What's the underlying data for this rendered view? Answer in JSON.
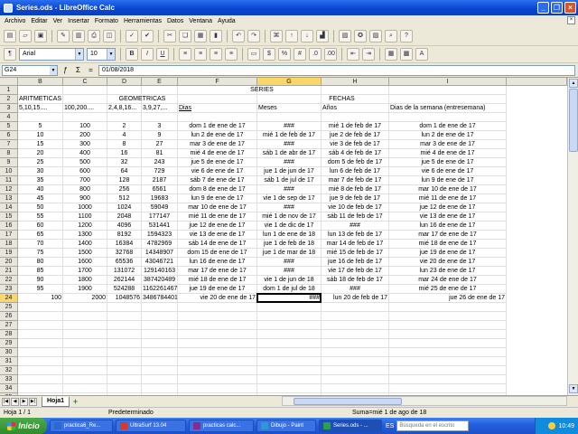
{
  "window": {
    "title": "Series.ods - LibreOffice Calc"
  },
  "menu": [
    "Archivo",
    "Editar",
    "Ver",
    "Insertar",
    "Formato",
    "Herramientas",
    "Datos",
    "Ventana",
    "Ayuda"
  ],
  "font": {
    "name": "Arial",
    "size": "10"
  },
  "formula_bar": {
    "cell_ref": "G24",
    "content": "01/08/2018"
  },
  "columns": [
    "B",
    "C",
    "D",
    "E",
    "F",
    "G",
    "H",
    "I"
  ],
  "selected": {
    "column": "G",
    "row": "24"
  },
  "rows": [
    "1",
    "2",
    "3",
    "4",
    "5",
    "6",
    "7",
    "8",
    "9",
    "10",
    "11",
    "12",
    "13",
    "14",
    "15",
    "16",
    "17",
    "18",
    "19",
    "20",
    "21",
    "22",
    "23",
    "24",
    "25",
    "26",
    "27",
    "28",
    "29",
    "30",
    "31",
    "32",
    "33",
    "34",
    "35",
    "36"
  ],
  "headings": {
    "series": "SERIES",
    "aritmeticas": "ARITMETICAS",
    "geometricas": "GEOMETRICAS",
    "fechas": "FECHAS",
    "ar_1": "5,10,15....",
    "ar_2": "100,200....",
    "geo_1": "2,4,8,16...",
    "geo_2": "3,9,27,...",
    "dias": "Dias",
    "meses": "Meses",
    "anios": "Años",
    "dias_semana": "Dias de la semana (entresemana)"
  },
  "table": [
    [
      "5",
      "100",
      "2",
      "3",
      "dom 1 de ene de 17",
      "###",
      "mié 1 de feb de 17",
      "dom 1 de ene de 17"
    ],
    [
      "10",
      "200",
      "4",
      "9",
      "lun 2 de ene de 17",
      "mié 1 de feb de 17",
      "jue 2 de feb de 17",
      "lun 2 de ene de 17"
    ],
    [
      "15",
      "300",
      "8",
      "27",
      "mar 3 de ene de 17",
      "###",
      "vie 3 de feb de 17",
      "mar 3 de ene de 17"
    ],
    [
      "20",
      "400",
      "16",
      "81",
      "mié 4 de ene de 17",
      "sáb 1 de abr de 17",
      "sáb 4 de feb de 17",
      "mié 4 de ene de 17"
    ],
    [
      "25",
      "500",
      "32",
      "243",
      "jue 5 de ene de 17",
      "###",
      "dom 5 de feb de 17",
      "jue 5 de ene de 17"
    ],
    [
      "30",
      "600",
      "64",
      "729",
      "vie 6 de ene de 17",
      "jue 1 de jun de 17",
      "lun 6 de feb de 17",
      "vie 6 de ene de 17"
    ],
    [
      "35",
      "700",
      "128",
      "2187",
      "sáb 7 de ene de 17",
      "sáb 1 de jul de 17",
      "mar 7 de feb de 17",
      "lun 9 de ene de 17"
    ],
    [
      "40",
      "800",
      "256",
      "6561",
      "dom 8 de ene de 17",
      "###",
      "mié 8 de feb de 17",
      "mar 10 de ene de 17"
    ],
    [
      "45",
      "900",
      "512",
      "19683",
      "lun 9 de ene de 17",
      "vie 1 de sep de 17",
      "jue 9 de feb de 17",
      "mié 11 de ene de 17"
    ],
    [
      "50",
      "1000",
      "1024",
      "59049",
      "mar 10 de ene de 17",
      "###",
      "vie 10 de feb de 17",
      "jue 12 de ene de 17"
    ],
    [
      "55",
      "1100",
      "2048",
      "177147",
      "mié 11 de ene de 17",
      "mié 1 de nov de 17",
      "sáb 11 de feb de 17",
      "vie 13 de ene de 17"
    ],
    [
      "60",
      "1200",
      "4096",
      "531441",
      "jue 12 de ene de 17",
      "vie 1 de dic de 17",
      "###",
      "lun 16 de ene de 17"
    ],
    [
      "65",
      "1300",
      "8192",
      "1594323",
      "vie 13 de ene de 17",
      "lun 1 de ene de 18",
      "lun 13 de feb de 17",
      "mar 17 de ene de 17"
    ],
    [
      "70",
      "1400",
      "16384",
      "4782969",
      "sáb 14 de ene de 17",
      "jue 1 de feb de 18",
      "mar 14 de feb de 17",
      "mié 18 de ene de 17"
    ],
    [
      "75",
      "1500",
      "32768",
      "14348907",
      "dom 15 de ene de 17",
      "jue 1 de mar de 18",
      "mié 15 de feb de 17",
      "jue 19 de ene de 17"
    ],
    [
      "80",
      "1600",
      "65536",
      "43046721",
      "lun 16 de ene de 17",
      "###",
      "jue 16 de feb de 17",
      "vie 20 de ene de 17"
    ],
    [
      "85",
      "1700",
      "131072",
      "129140163",
      "mar 17 de ene de 17",
      "###",
      "vie 17 de feb de 17",
      "lun 23 de ene de 17"
    ],
    [
      "90",
      "1800",
      "262144",
      "387420489",
      "mié 18 de ene de 17",
      "vie 1 de jun de 18",
      "sáb 18 de feb de 17",
      "mar 24 de ene de 17"
    ],
    [
      "95",
      "1900",
      "524288",
      "1162261467",
      "jue 19 de ene de 17",
      "dom 1 de jul de 18",
      "###",
      "mié 25 de ene de 17"
    ],
    [
      "100",
      "2000",
      "1048576",
      "3486784401",
      "vie 20 de ene de 17",
      "###",
      "lun 20 de feb de 17",
      "jue 26 de ene de 17"
    ]
  ],
  "tabs": {
    "sheet": "Hoja1"
  },
  "status": {
    "page": "Hoja 1 / 1",
    "style": "Predeterminado",
    "sum": "Suma=mié 1 de ago de 18"
  },
  "taskbar": {
    "start": "Inicio",
    "items": [
      "practica6_Re...",
      "UltraSurf 13.04",
      "practicas calc...",
      "Dibujo - Paint",
      "Series.ods - ..."
    ],
    "lang": "ES",
    "search": "Búsqueda en el escrito",
    "time": "10:49"
  }
}
